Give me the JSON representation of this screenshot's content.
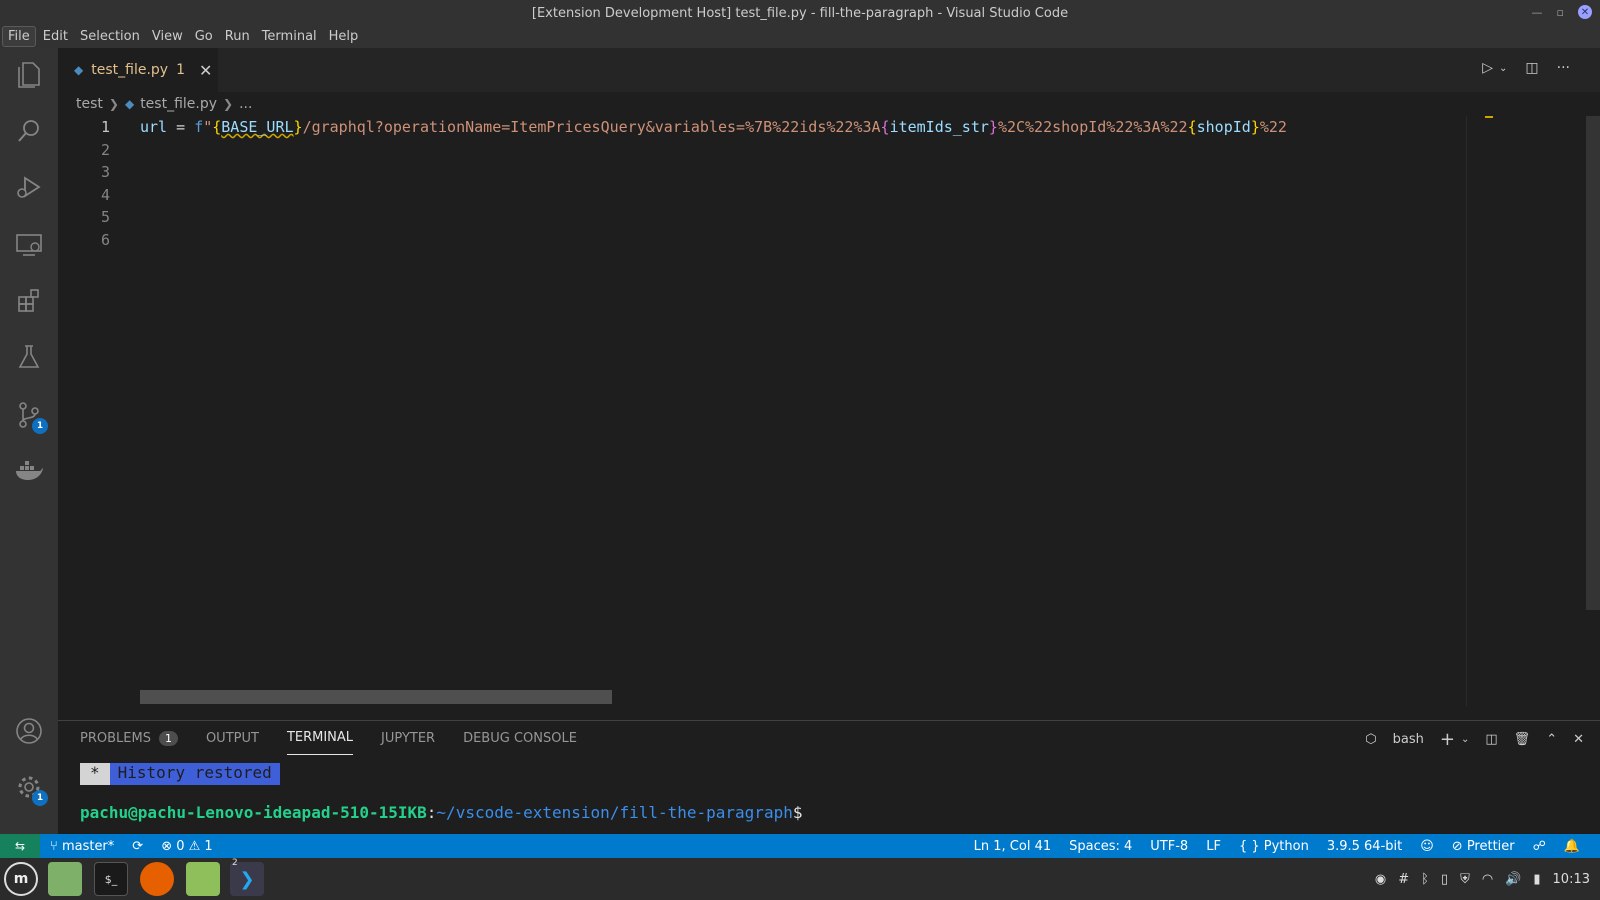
{
  "window": {
    "title": "[Extension Development Host] test_file.py - fill-the-paragraph - Visual Studio Code"
  },
  "menu": [
    "File",
    "Edit",
    "Selection",
    "View",
    "Go",
    "Run",
    "Terminal",
    "Help"
  ],
  "activity_bar": {
    "icons": [
      "explorer-icon",
      "search-icon",
      "run-debug-icon",
      "remote-explorer-icon",
      "extensions-icon",
      "testing-icon",
      "source-control-icon",
      "docker-icon",
      "account-icon",
      "settings-gear-icon"
    ],
    "source_control_badge": "1",
    "settings_badge": "1"
  },
  "tab": {
    "label": "test_file.py",
    "problem_count": "1"
  },
  "breadcrumb": {
    "folder": "test",
    "file": "test_file.py",
    "more": "..."
  },
  "editor": {
    "line_numbers": [
      "1",
      "2",
      "3",
      "4",
      "5",
      "6"
    ],
    "line1": {
      "var": "url",
      "eq": " = ",
      "prefix": "f",
      "quote": "\"",
      "brace_open_1": "{",
      "interp_1": "BASE_URL",
      "brace_close_1": "}",
      "str_1": "/graphql?operationName=ItemPricesQuery&variables=%7B%22ids%22%3A",
      "brace_open_2": "{",
      "interp_2": "itemIds_str",
      "brace_close_2": "}",
      "str_2": "%2C%22shopId%22%3A%22",
      "brace_open_3": "{",
      "interp_3": "shopId",
      "brace_close_3": "}",
      "str_3": "%22"
    }
  },
  "panel": {
    "tabs": [
      "PROBLEMS",
      "OUTPUT",
      "TERMINAL",
      "JUPYTER",
      "DEBUG CONSOLE"
    ],
    "problems_count": "1",
    "active_tab": "TERMINAL",
    "shell": "bash",
    "terminal": {
      "star": "*",
      "history": "History restored",
      "user_host": "pachu@pachu-Lenovo-ideapad-510-15IKB",
      "colon": ":",
      "path": "~/vscode-extension/fill-the-paragraph",
      "dollar": "$"
    }
  },
  "status": {
    "branch": "master*",
    "errors": "0",
    "warnings": "1",
    "position": "Ln 1, Col 41",
    "spaces": "Spaces: 4",
    "encoding": "UTF-8",
    "eol": "LF",
    "language": "Python",
    "interpreter": "3.9.5 64-bit",
    "formatter": "Prettier"
  },
  "taskbar": {
    "clock": "10:13",
    "vscode_window_count": "2"
  },
  "colors": {
    "status_bar": "#007acc",
    "editor_bg": "#1e1e1e",
    "string": "#ce9178",
    "tab_modified": "#e2c08d"
  }
}
